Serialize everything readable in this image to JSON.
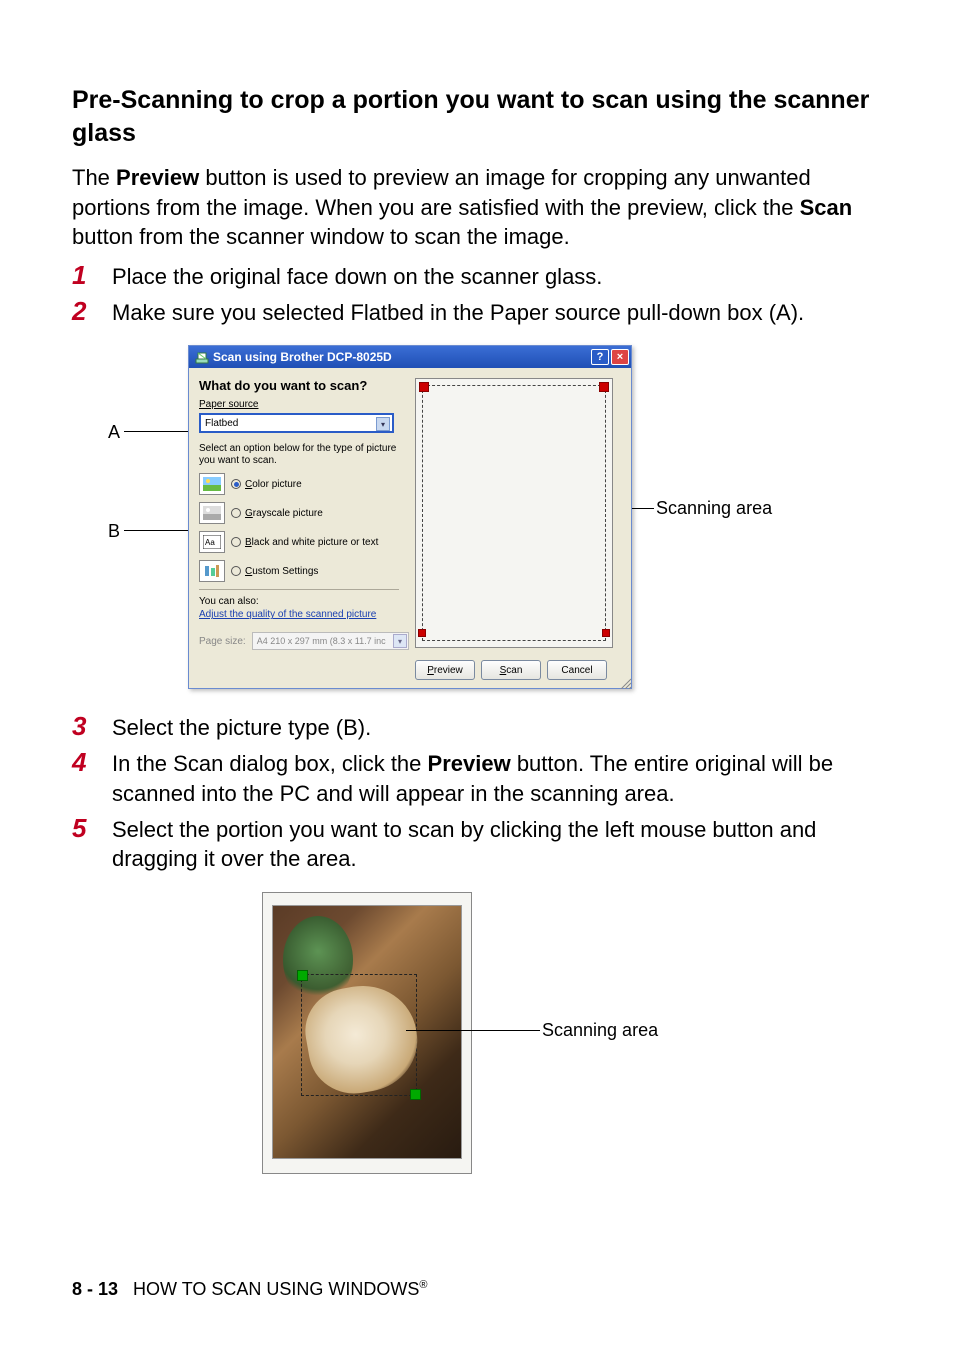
{
  "heading": "Pre-Scanning to crop a portion you want to scan using the scanner glass",
  "intro_before_preview": "The ",
  "intro_preview": "Preview",
  "intro_mid": " button is used to preview an image for cropping any unwanted portions from the image. When you are satisfied with the preview, click the ",
  "intro_scan": "Scan",
  "intro_after": " button from the scanner window to scan the image.",
  "steps_a": {
    "1": "Place the original face down on the scanner glass.",
    "2": "Make sure you selected Flatbed in the Paper source pull-down box (A)."
  },
  "callouts": {
    "A": "A",
    "B": "B",
    "scanning_area": "Scanning area"
  },
  "dialog": {
    "title": "Scan using Brother DCP-8025D",
    "question": "What do you want to scan?",
    "paper_source_label": "Paper source",
    "paper_source_value": "Flatbed",
    "select_text": "Select an option below for the type of picture you want to scan.",
    "options": {
      "color": "olor picture",
      "color_u": "C",
      "gray": "rayscale picture",
      "gray_u": "G",
      "bw": "lack and white picture or text",
      "bw_u": "B",
      "custom": "ustom Settings",
      "custom_u": "C"
    },
    "you_can_also": "You can also:",
    "adjust_link": "Adjust the quality of the scanned picture",
    "page_size_label": "Page size:",
    "page_size_value": "A4 210 x 297 mm (8.3 x 11.7 inc",
    "buttons": {
      "preview": "review",
      "preview_u": "P",
      "scan": "can",
      "scan_u": "S",
      "cancel": "Cancel"
    }
  },
  "steps_b": {
    "3": "Select the picture type (B).",
    "4_before": "In the Scan dialog box, click the ",
    "4_bold": "Preview",
    "4_after": " button. The entire original will be scanned into the PC and will appear in the scanning area.",
    "5": "Select the portion you want to scan by clicking the left mouse button and dragging it over the area."
  },
  "footer": {
    "page": "8 - 13",
    "text": "HOW TO SCAN USING WINDOWS",
    "reg": "®"
  }
}
